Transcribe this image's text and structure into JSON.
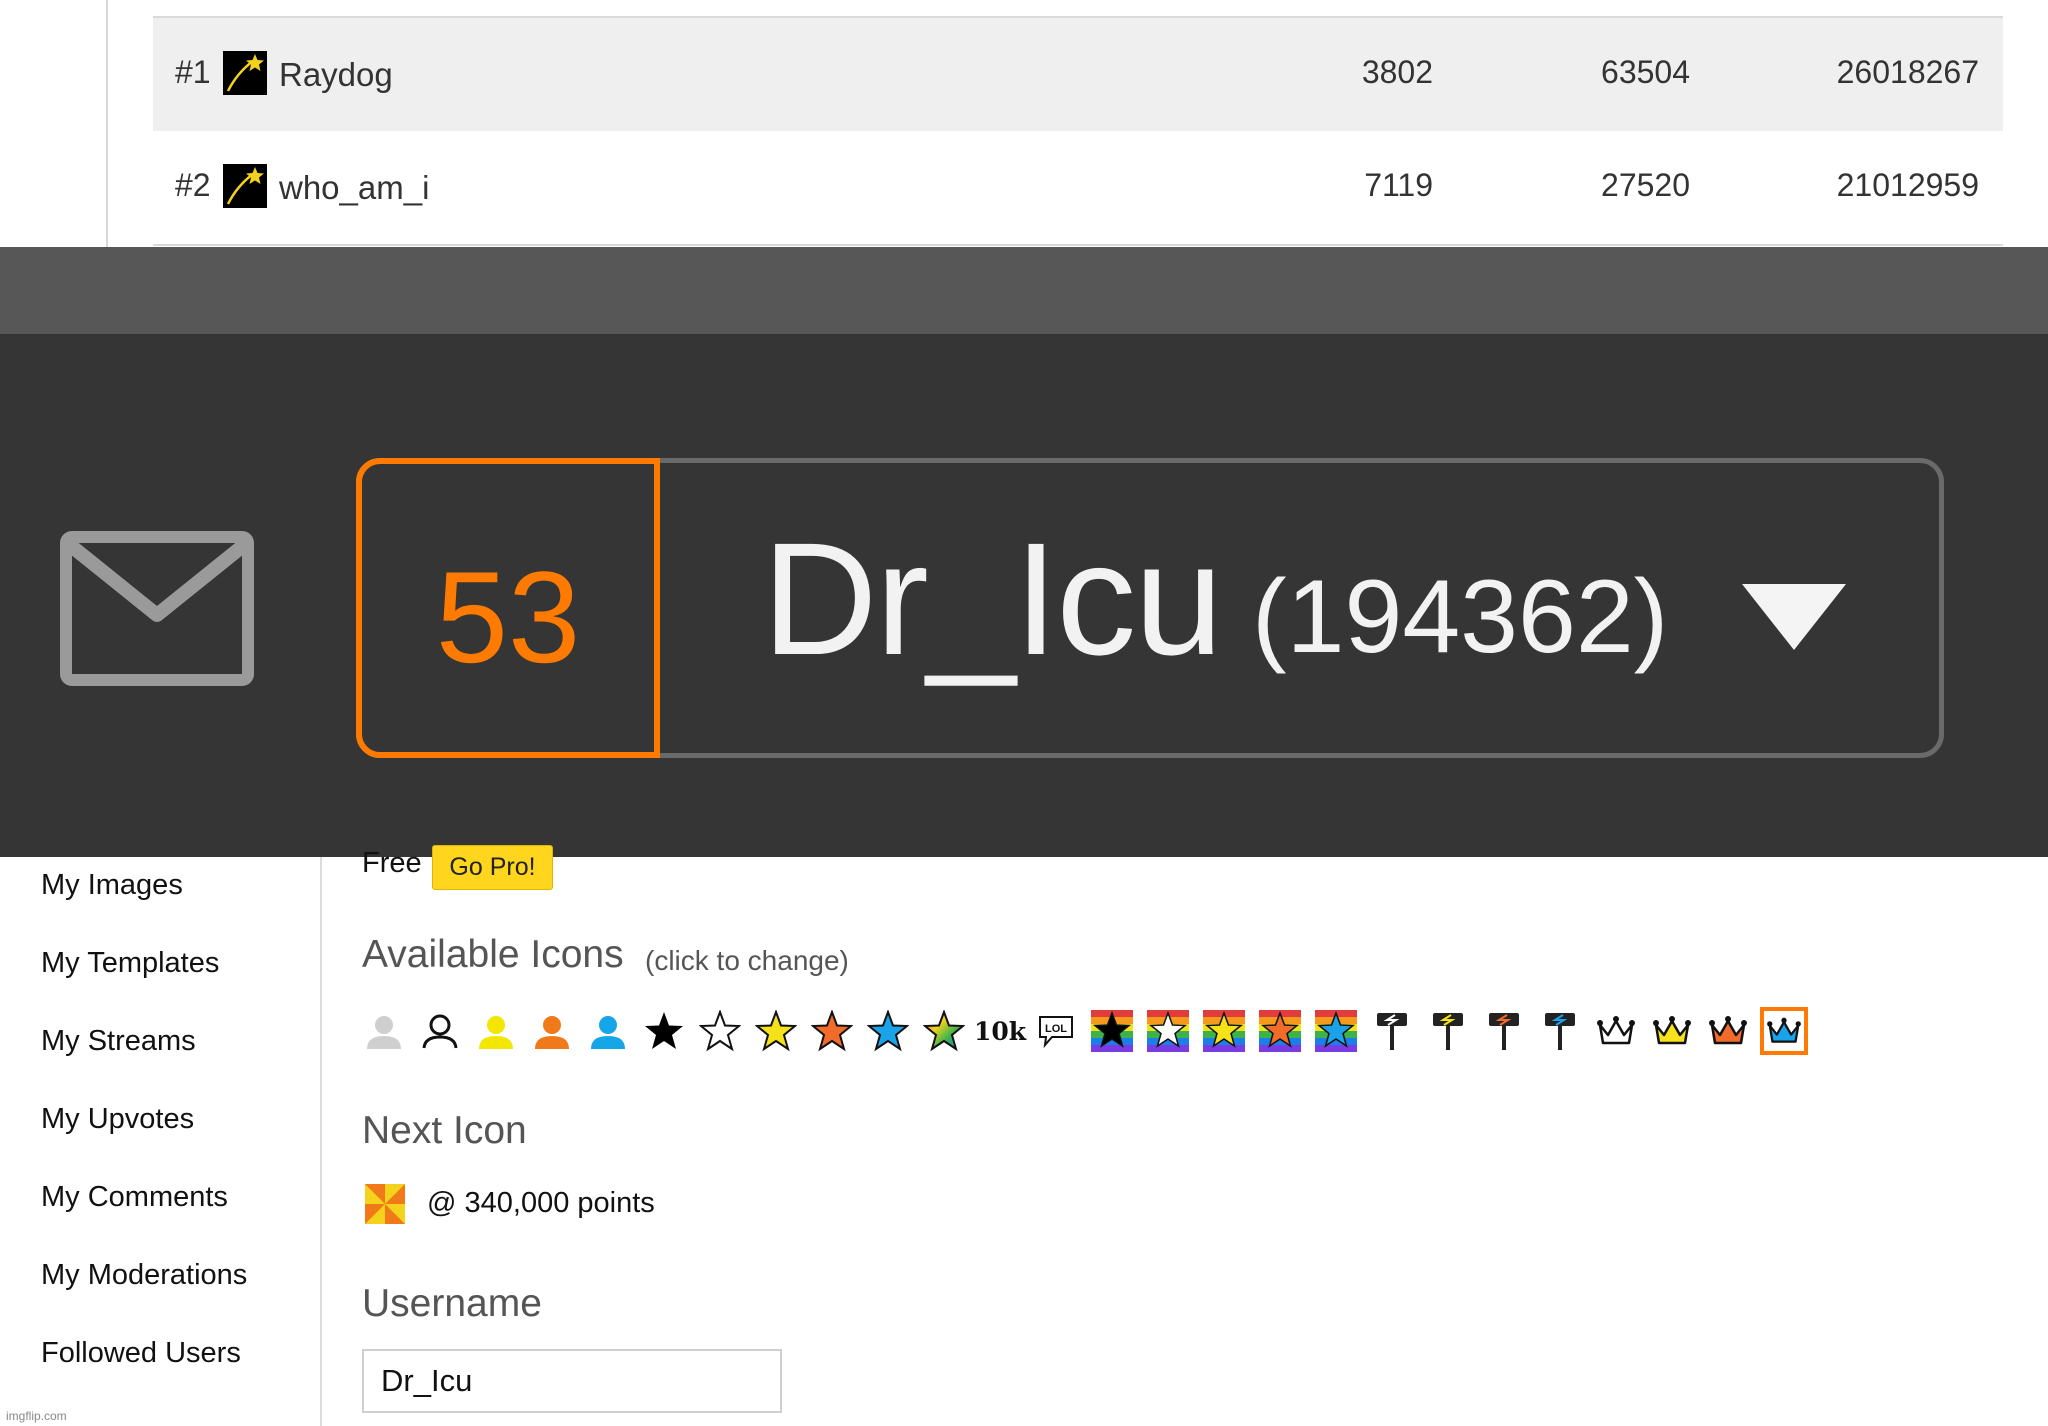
{
  "leaderboard": {
    "rows": [
      {
        "rank": "#1",
        "name": "Raydog",
        "col1": "3802",
        "col2": "63504",
        "col3": "26018267"
      },
      {
        "rank": "#2",
        "name": "who_am_i",
        "col1": "7119",
        "col2": "27520",
        "col3": "21012959"
      }
    ]
  },
  "header": {
    "notification_count": "53",
    "username": "Dr_Icu",
    "points": "(194362)",
    "accent_color": "#ff7a00"
  },
  "account": {
    "plan": "Free",
    "go_pro_label": "Go Pro!"
  },
  "sidebar": {
    "items": [
      {
        "label": "My Images"
      },
      {
        "label": "My Templates"
      },
      {
        "label": "My Streams"
      },
      {
        "label": "My Upvotes"
      },
      {
        "label": "My Comments"
      },
      {
        "label": "My Moderations"
      },
      {
        "label": "Followed Users"
      }
    ]
  },
  "icons_section": {
    "title": "Available Icons",
    "hint": "(click to change)",
    "icons": [
      "gray-user-icon",
      "outline-user-icon",
      "yellow-user-icon",
      "orange-user-icon",
      "blue-user-icon",
      "black-star-icon",
      "white-star-icon",
      "yellow-star-icon",
      "orange-star-icon",
      "blue-star-icon",
      "rainbow-star-icon",
      "10k-icon",
      "lol-bubble-icon",
      "black-star-stripes-icon",
      "white-star-stripes-icon",
      "yellow-star-stripes-icon",
      "orange-star-stripes-icon",
      "blue-star-stripes-icon",
      "white-hammer-icon",
      "yellow-hammer-icon",
      "orange-hammer-icon",
      "blue-hammer-icon",
      "white-crown-icon",
      "yellow-crown-icon",
      "orange-crown-icon",
      "blue-crown-icon"
    ],
    "text_10k": "10k",
    "text_lol": "LOL",
    "selected_icon": "blue-crown-icon"
  },
  "next_icon_section": {
    "title": "Next Icon",
    "text": "@ 340,000 points",
    "icon": "pinwheel-icon"
  },
  "username_section": {
    "title": "Username",
    "value": "Dr_Icu"
  },
  "watermark": "imgflip.com"
}
